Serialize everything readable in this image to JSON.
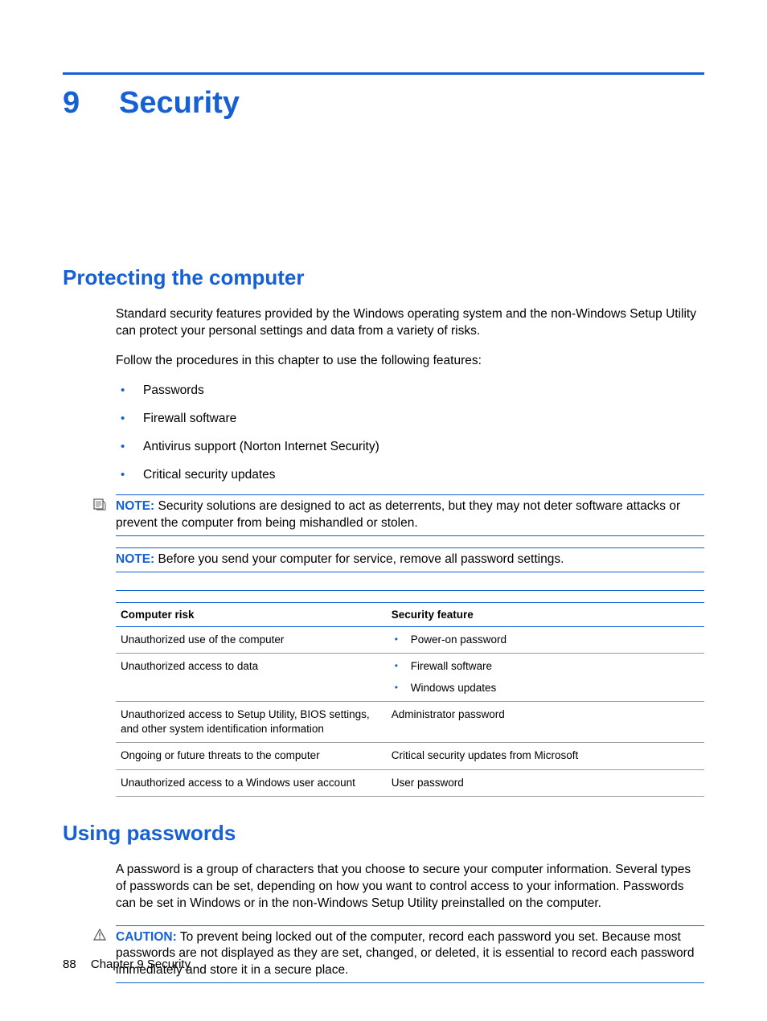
{
  "chapter": {
    "number": "9",
    "title": "Security"
  },
  "section1": {
    "heading": "Protecting the computer",
    "para1": "Standard security features provided by the Windows operating system and the non-Windows Setup Utility can protect your personal settings and data from a variety of risks.",
    "para2": "Follow the procedures in this chapter to use the following features:",
    "bullets": {
      "0": "Passwords",
      "1": "Firewall software",
      "2": "Antivirus support (Norton Internet Security)",
      "3": "Critical security updates"
    },
    "note1_label": "NOTE:",
    "note1_text": "Security solutions are designed to act as deterrents, but they may not deter software attacks or prevent the computer from being mishandled or stolen.",
    "note2_label": "NOTE:",
    "note2_text": "Before you send your computer for service, remove all password settings.",
    "table": {
      "head_risk": "Computer risk",
      "head_feat": "Security feature",
      "rows": {
        "0": {
          "risk": "Unauthorized use of the computer",
          "feat_bullets": {
            "0": "Power-on password"
          }
        },
        "1": {
          "risk": "Unauthorized access to data",
          "feat_bullets": {
            "0": "Firewall software",
            "1": "Windows updates"
          }
        },
        "2": {
          "risk": "Unauthorized access to Setup Utility, BIOS settings, and other system identification information",
          "feat_text": "Administrator password"
        },
        "3": {
          "risk": "Ongoing or future threats to the computer",
          "feat_text": "Critical security updates from Microsoft"
        },
        "4": {
          "risk": "Unauthorized access to a Windows user account",
          "feat_text": "User password"
        }
      }
    }
  },
  "section2": {
    "heading": "Using passwords",
    "para1": "A password is a group of characters that you choose to secure your computer information. Several types of passwords can be set, depending on how you want to control access to your information. Passwords can be set in Windows or in the non-Windows Setup Utility preinstalled on the computer.",
    "caution_label": "CAUTION:",
    "caution_text": "To prevent being locked out of the computer, record each password you set. Because most passwords are not displayed as they are set, changed, or deleted, it is essential to record each password immediately and store it in a secure place."
  },
  "footer": {
    "page": "88",
    "label": "Chapter 9   Security"
  }
}
